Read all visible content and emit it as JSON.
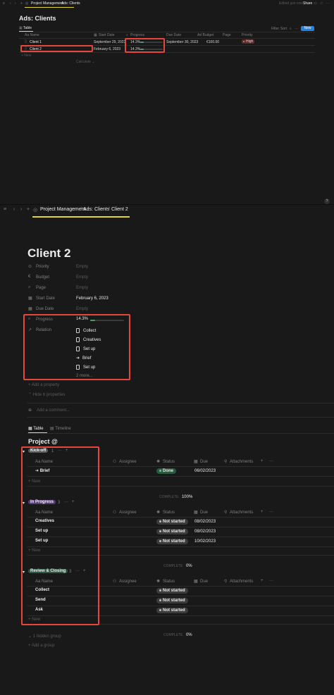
{
  "top": {
    "nav_icons": [
      "‹",
      "›",
      "+"
    ],
    "breadcrumb": [
      "Project Management",
      "Ads: Clients"
    ],
    "edited_text": "Edited just now",
    "share_label": "Share",
    "title": "Ads: Clients",
    "view_tab": "Table",
    "filter_label": "Filter",
    "sort_label": "Sort",
    "new_label": "New",
    "columns": [
      "Aa Name",
      "Start Date",
      "Progress",
      "Due Date",
      "Ad Budget",
      "Page",
      "Priority"
    ],
    "rows": [
      {
        "name": "Client 1",
        "start": "September 29, 2023",
        "progress": "14.3%",
        "progress_value": 0.143,
        "due": "September 30, 2023",
        "budget": "€100.00",
        "priority": "High"
      },
      {
        "name": "Client 2",
        "start": "February 6, 2023",
        "progress": "14.3%",
        "progress_value": 0.143,
        "due": "",
        "budget": "",
        "priority": ""
      }
    ],
    "new_row": "+ New",
    "calculate": "Calculate ⌄",
    "help": "?"
  },
  "bottom": {
    "nav_icons": [
      "≡",
      "‹",
      "›",
      "+"
    ],
    "breadcrumb": [
      "Project Management",
      "Ads: Clients",
      "Client 2"
    ],
    "title": "Client 2",
    "properties": [
      {
        "icon": "⊙",
        "label": "Priority",
        "value": "Empty"
      },
      {
        "icon": "€",
        "label": "Budget",
        "value": "Empty"
      },
      {
        "icon": "⌕",
        "label": "Page",
        "value": "Empty"
      },
      {
        "icon": "▦",
        "label": "Start Date",
        "value": "February 6, 2023"
      },
      {
        "icon": "▦",
        "label": "Due Date",
        "value": "Empty"
      }
    ],
    "progress_label": "Progress",
    "progress_value": "14.3%",
    "progress_fraction": 0.143,
    "relation_label": "Relation",
    "relations": [
      "Collect",
      "Creatives",
      "Set up",
      "Brief",
      "Set up"
    ],
    "relations_more": "2 more...",
    "add_property": "+ Add a property",
    "hide_properties": "⌃ Hide 6 properties",
    "add_comment": "Add a comment...",
    "tabs": [
      "Table",
      "Timeline"
    ],
    "db_title": "Project @",
    "col_name": "Aa Name",
    "col_assignee": "Assignee",
    "col_status": "Status",
    "col_due": "Due",
    "col_attachments": "Attachments",
    "complete_label": "COMPLETE",
    "new_label": "+ New",
    "groups": [
      {
        "name": "Kick-off",
        "count": "1",
        "color": "#5a5a5a",
        "complete": "100%",
        "rows": [
          {
            "name": "➔ Brief",
            "status": "Done",
            "status_color": "#2b593f",
            "dot": "#6fc390",
            "due": "06/02/2023"
          }
        ]
      },
      {
        "name": "In Progress",
        "count": "3",
        "color": "#5b3f7a",
        "complete": "0%",
        "rows": [
          {
            "name": "Creatives",
            "status": "Not started",
            "status_color": "#3b3b3b",
            "dot": "#bdbdbd",
            "due": "08/02/2023"
          },
          {
            "name": "Set up",
            "status": "Not started",
            "status_color": "#3b3b3b",
            "dot": "#bdbdbd",
            "due": "08/02/2023"
          },
          {
            "name": "Set up",
            "status": "Not started",
            "status_color": "#3b3b3b",
            "dot": "#bdbdbd",
            "due": "10/02/2023"
          }
        ]
      },
      {
        "name": "Review & Closing",
        "count": "3",
        "color": "#2e5a45",
        "complete": "0%",
        "rows": [
          {
            "name": "Collect",
            "status": "Not started",
            "status_color": "#3b3b3b",
            "dot": "#bdbdbd",
            "due": ""
          },
          {
            "name": "Send",
            "status": "Not started",
            "status_color": "#3b3b3b",
            "dot": "#bdbdbd",
            "due": ""
          },
          {
            "name": "Ask",
            "status": "Not started",
            "status_color": "#3b3b3b",
            "dot": "#bdbdbd",
            "due": ""
          }
        ]
      }
    ],
    "hidden_group": "⌄ 1 hidden group",
    "add_group": "+ Add a group"
  },
  "colors": {
    "red_highlight": "#e5483a",
    "yellow_underline": "#e7d33b",
    "blue_button": "#2383e2",
    "progress_green": "#4d9b6d",
    "high_priority": "#5c2b2b"
  }
}
